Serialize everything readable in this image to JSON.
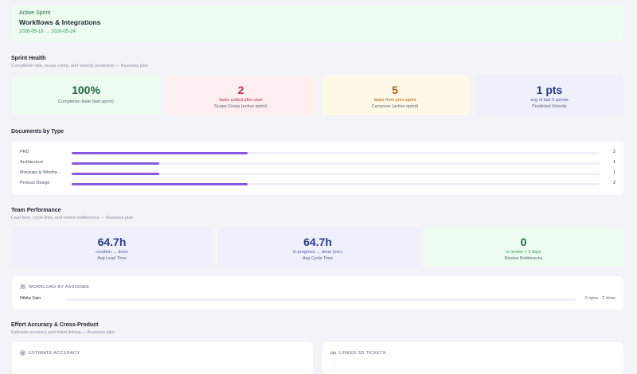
{
  "sprint": {
    "kicker": "Active Sprint",
    "title": "Workflows & Integrations",
    "dates": "2026-05-18 → 2026-05-24"
  },
  "sprint_health": {
    "title": "Sprint Health",
    "subtitle": "Completion rate, scope creep, and velocity prediction — Business plan",
    "stats": [
      {
        "value": "100%",
        "detail": "",
        "label": "Completion Rate (last sprint)",
        "color": "#1f6b3f"
      },
      {
        "value": "2",
        "detail": "tasks added after start",
        "label": "Scope Creep (active sprint)",
        "color": "#c0344a"
      },
      {
        "value": "5",
        "detail": "tasks from prev sprint",
        "label": "Carryover (active sprint)",
        "color": "#b45d12"
      },
      {
        "value": "1 pts",
        "detail": "avg of last 3 sprints",
        "label": "Predicted Velocity",
        "color": "#2d3a8c"
      }
    ]
  },
  "documents": {
    "title": "Documents by Type",
    "rows": [
      {
        "name": "PRD",
        "count": "2",
        "fraction": 0.333
      },
      {
        "name": "Architecture",
        "count": "1",
        "fraction": 0.1665
      },
      {
        "name": "Mockups & Wirefra...",
        "count": "1",
        "fraction": 0.1665
      },
      {
        "name": "Product Design",
        "count": "2",
        "fraction": 0.333
      }
    ]
  },
  "team": {
    "title": "Team Performance",
    "subtitle": "Lead time, cycle time, and review bottlenecks — Business plan",
    "stats": [
      {
        "value": "64.7h",
        "detail": "creation → done",
        "label": "Avg Lead Time",
        "color": "#2d3a8c"
      },
      {
        "value": "64.7h",
        "detail": "in-progress → done (est.)",
        "label": "Avg Cycle Time",
        "color": "#2d3a8c"
      },
      {
        "value": "0",
        "detail": "in review > 3 days",
        "label": "Review Bottlenecks",
        "color": "#1f6b3f"
      }
    ]
  },
  "workload": {
    "title": "WORKLOAD BY ASSIGNEE",
    "assignee": "Nikita Sain",
    "summary": "0 open · 2 done"
  },
  "effort": {
    "title": "Effort Accuracy & Cross-Product",
    "subtitle": "Estimate accuracy and ticket linking — Business plan",
    "estimate_title": "ESTIMATE ACCURACY",
    "linked_title": "LINKED SD TICKETS"
  }
}
